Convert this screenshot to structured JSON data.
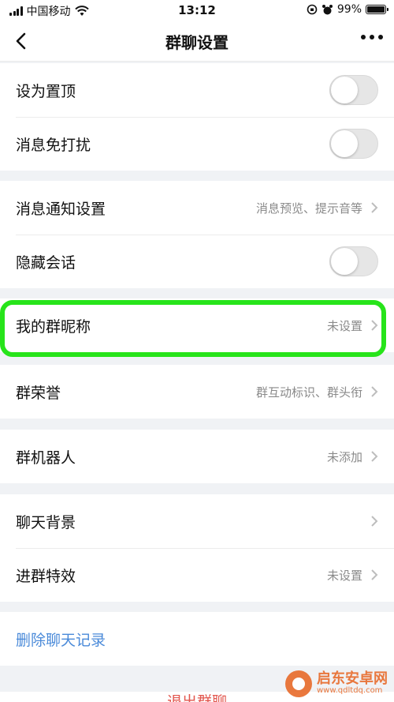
{
  "status_bar": {
    "carrier": "中国移动",
    "time": "13:12",
    "battery_percent": "99%"
  },
  "navbar": {
    "title": "群聊设置"
  },
  "groups": [
    {
      "rows": [
        {
          "label": "设为置顶",
          "toggle_on": false
        },
        {
          "label": "消息免打扰",
          "toggle_on": false
        }
      ]
    },
    {
      "rows": [
        {
          "label": "消息通知设置",
          "value": "消息预览、提示音等"
        },
        {
          "label": "隐藏会话",
          "toggle_on": false
        }
      ]
    },
    {
      "rows": [
        {
          "label": "我的群昵称",
          "value": "未设置"
        }
      ]
    },
    {
      "rows": [
        {
          "label": "群荣誉",
          "value": "群互动标识、群头衔"
        }
      ]
    },
    {
      "rows": [
        {
          "label": "群机器人",
          "value": "未添加"
        }
      ]
    },
    {
      "rows": [
        {
          "label": "聊天背景",
          "value": ""
        },
        {
          "label": "进群特效",
          "value": "未设置"
        }
      ]
    },
    {
      "rows": [
        {
          "label": "删除聊天记录"
        }
      ]
    }
  ],
  "exit_label": "退出群聊",
  "watermark": {
    "title": "启东安卓网",
    "url": "www.qdltdq.com"
  },
  "colors": {
    "highlight": "#27e41a",
    "link": "#4a8ad9",
    "danger": "#e2564e"
  }
}
